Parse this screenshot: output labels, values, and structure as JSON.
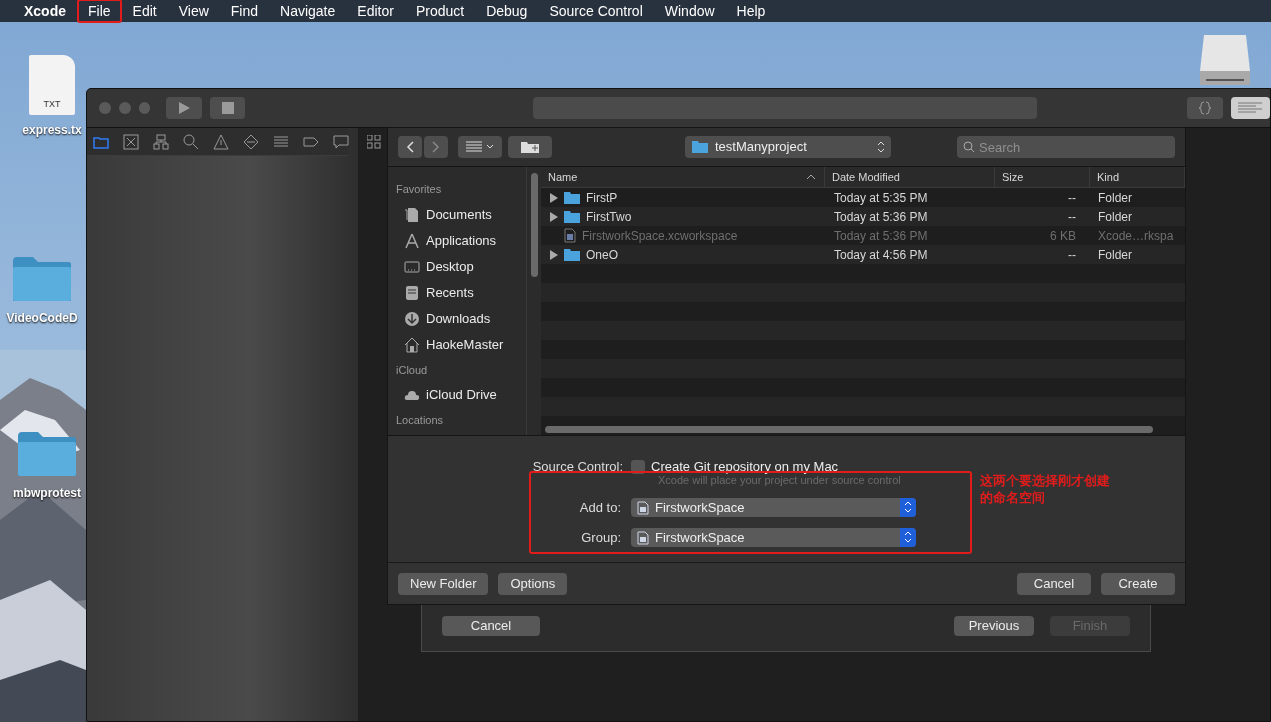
{
  "menu_bar": {
    "items": [
      {
        "label": "Xcode",
        "kind": "app",
        "annotated": false
      },
      {
        "label": "File",
        "kind": "menu",
        "annotated": true
      },
      {
        "label": "Edit",
        "kind": "menu",
        "annotated": false
      },
      {
        "label": "View",
        "kind": "menu",
        "annotated": false
      },
      {
        "label": "Find",
        "kind": "menu",
        "annotated": false
      },
      {
        "label": "Navigate",
        "kind": "menu",
        "annotated": false
      },
      {
        "label": "Editor",
        "kind": "menu",
        "annotated": false
      },
      {
        "label": "Product",
        "kind": "menu",
        "annotated": false
      },
      {
        "label": "Debug",
        "kind": "menu",
        "annotated": false
      },
      {
        "label": "Source Control",
        "kind": "menu",
        "annotated": false
      },
      {
        "label": "Window",
        "kind": "menu",
        "annotated": false
      },
      {
        "label": "Help",
        "kind": "menu",
        "annotated": false
      }
    ]
  },
  "desktop_icons": [
    {
      "label": "express.tx",
      "kind": "text-file",
      "badge": "TXT"
    },
    {
      "label": "VideoCodeD",
      "kind": "folder"
    },
    {
      "label": "mbwprotest",
      "kind": "folder"
    },
    {
      "kind": "disk"
    }
  ],
  "save_dialog": {
    "location": "testManyproject",
    "search": {
      "placeholder": "Search"
    },
    "sidebar": [
      {
        "heading": "Favorites",
        "items": [
          {
            "label": "Documents",
            "kind": "documents"
          },
          {
            "label": "Applications",
            "kind": "applications"
          },
          {
            "label": "Desktop",
            "kind": "desktop"
          },
          {
            "label": "Recents",
            "kind": "recents"
          },
          {
            "label": "Downloads",
            "kind": "downloads"
          },
          {
            "label": "HaokeMaster",
            "kind": "home"
          }
        ]
      },
      {
        "heading": "iCloud",
        "items": [
          {
            "label": "iCloud Drive",
            "kind": "cloud"
          }
        ]
      },
      {
        "heading": "Locations"
      }
    ],
    "columns": [
      {
        "label": "Name",
        "sorted": true
      },
      {
        "label": "Date Modified",
        "sorted": false
      },
      {
        "label": "Size",
        "sorted": false
      },
      {
        "label": "Kind",
        "sorted": false
      }
    ],
    "rows": [
      {
        "name": "FirstP",
        "date": "Today at 5:35 PM",
        "size": "--",
        "kind_label": "Folder",
        "kind": "folder",
        "disabled": false
      },
      {
        "name": "FirstTwo",
        "date": "Today at 5:36 PM",
        "size": "--",
        "kind_label": "Folder",
        "kind": "folder",
        "disabled": false
      },
      {
        "name": "FirstworkSpace.xcworkspace",
        "date": "Today at 5:36 PM",
        "size": "6 KB",
        "kind_label": "Xcode…rkspa",
        "kind": "workspace",
        "disabled": true
      },
      {
        "name": "OneO",
        "date": "Today at 4:56 PM",
        "size": "--",
        "kind_label": "Folder",
        "kind": "folder",
        "disabled": false
      }
    ],
    "source_control": {
      "label": "Source Control:",
      "checkbox": "Create Git repository on my Mac",
      "checked": false,
      "hint": "Xcode will place your project under source control"
    },
    "add_to": {
      "label": "Add to:",
      "value": "FirstworkSpace"
    },
    "group": {
      "label": "Group:",
      "value": "FirstworkSpace"
    },
    "left_buttons": [
      "New Folder",
      "Options"
    ],
    "right_buttons": [
      "Cancel",
      "Create"
    ]
  },
  "back_sheet": {
    "buttons": [
      {
        "label": "Cancel",
        "disabled": false
      },
      {
        "label": "Previous",
        "disabled": false
      },
      {
        "label": "Finish",
        "disabled": true
      }
    ]
  },
  "annotation": {
    "text": "这两个要选择刚才创建的命名空间"
  }
}
